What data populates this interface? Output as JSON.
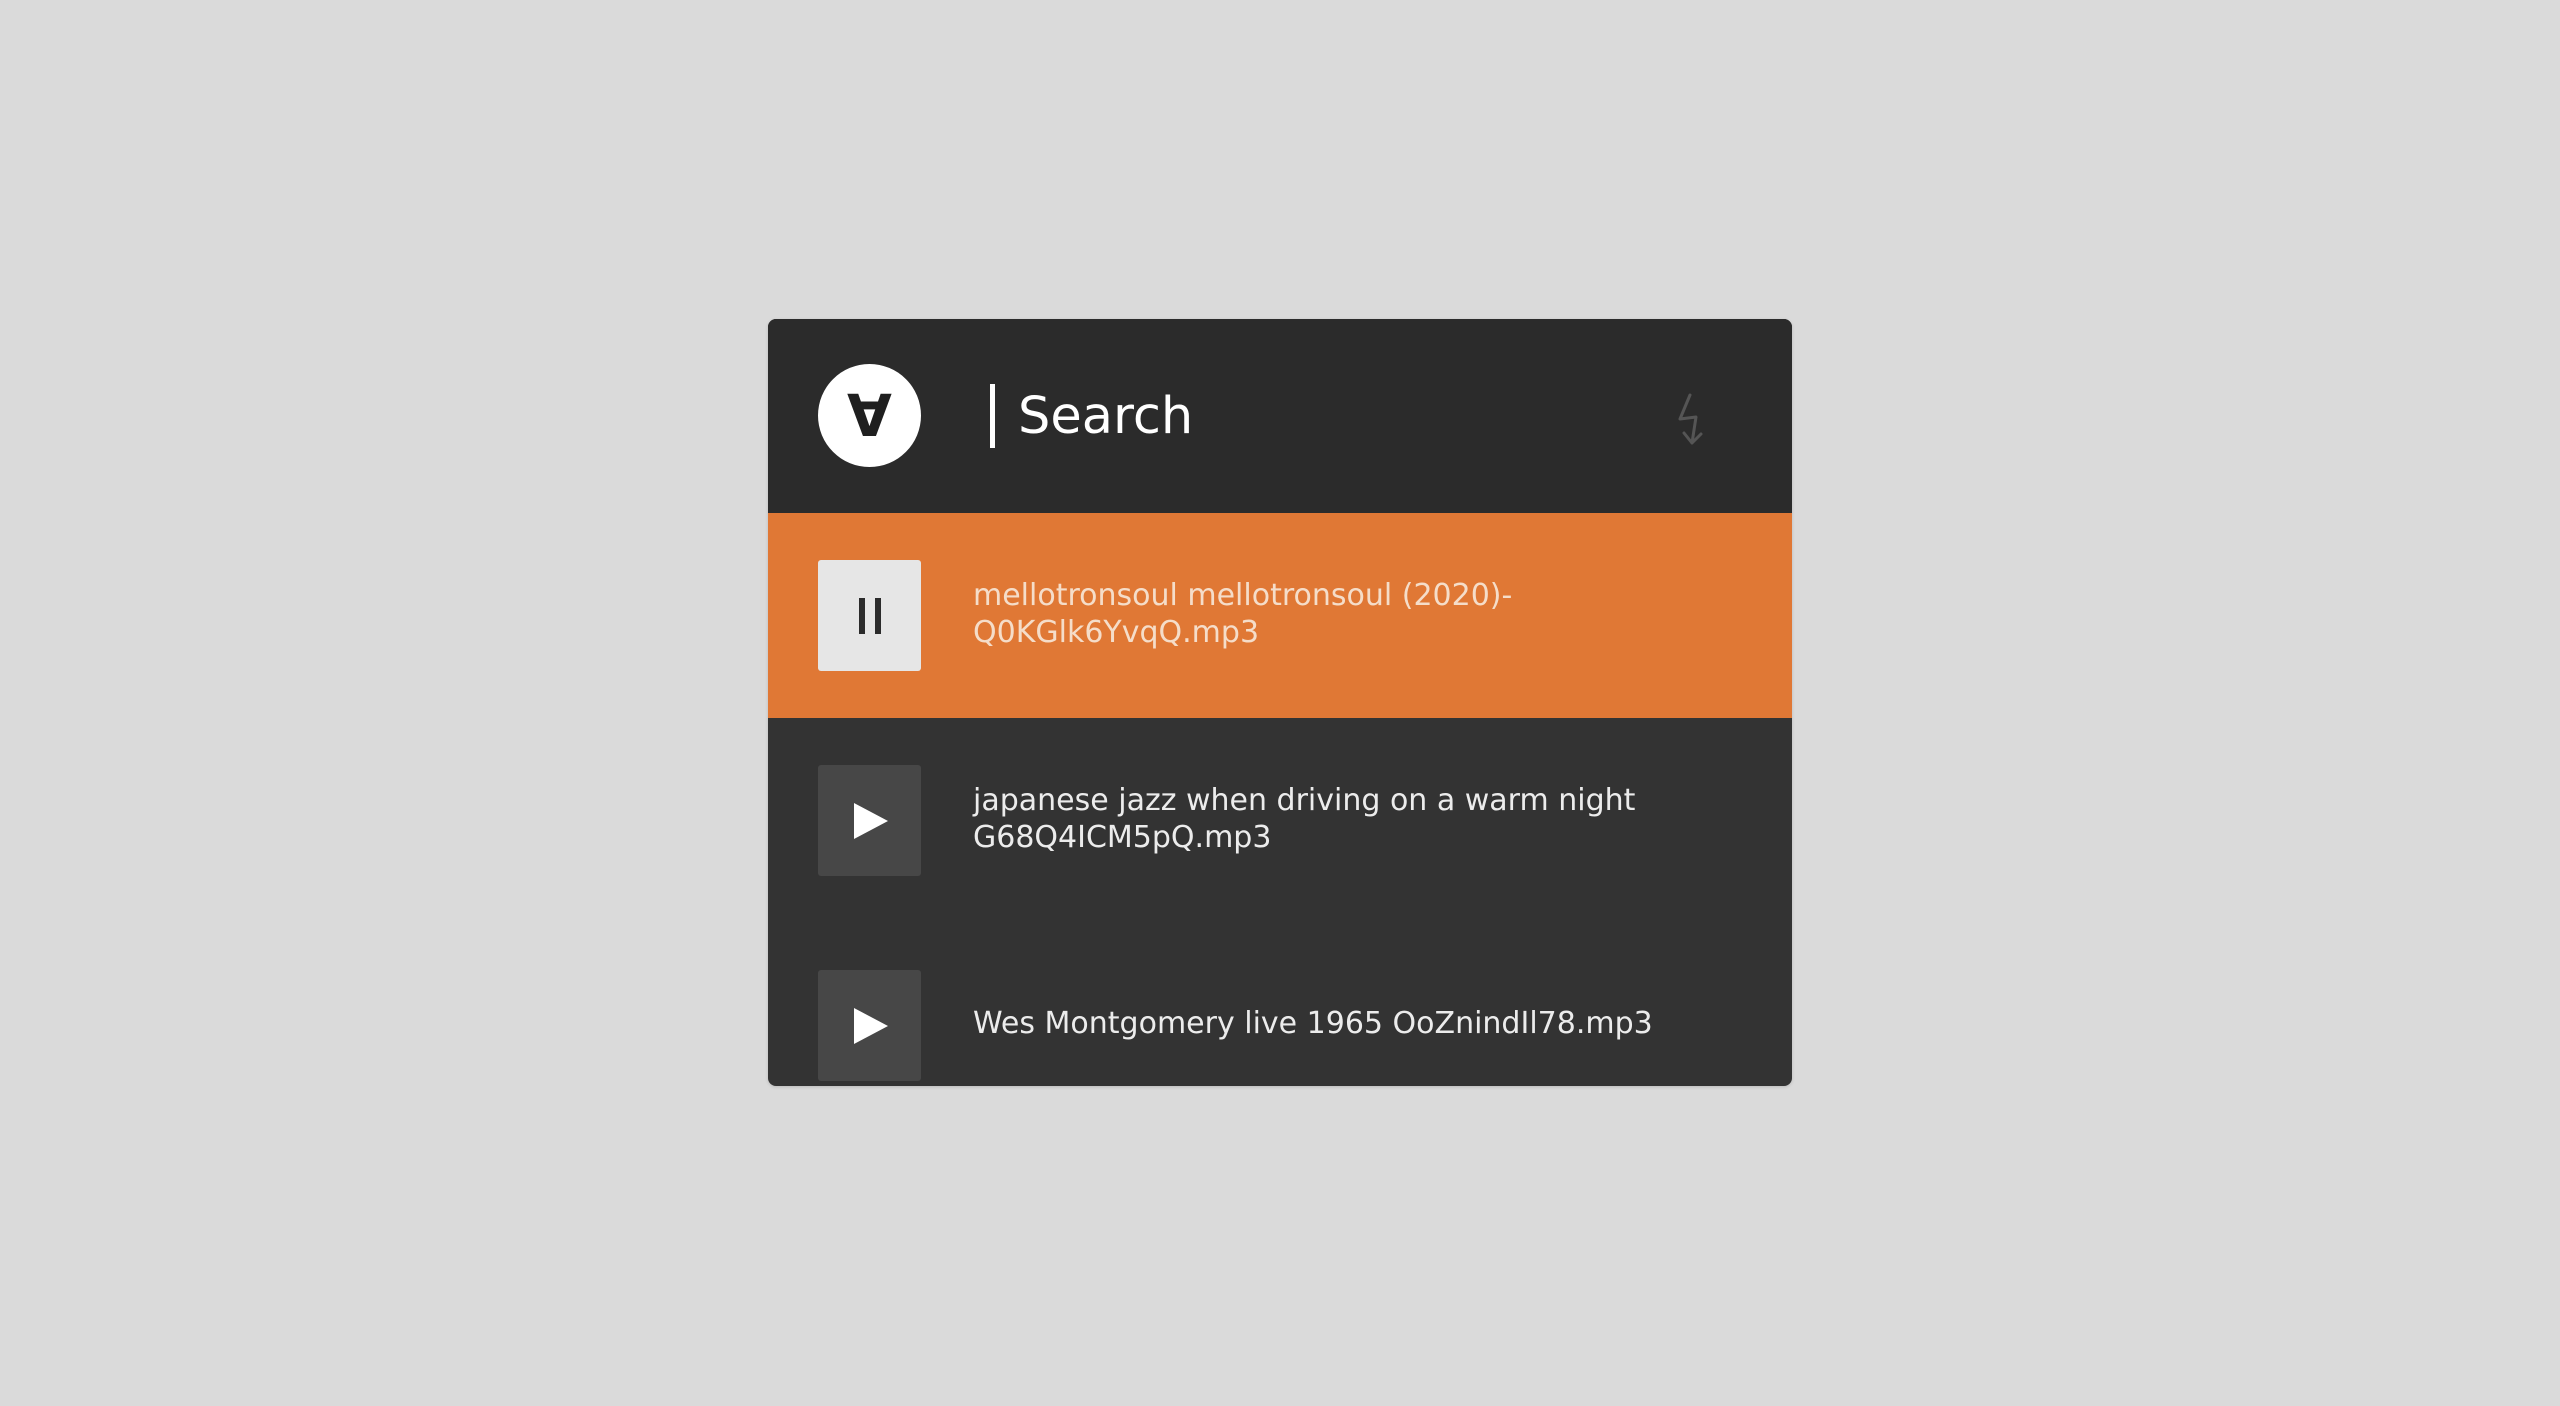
{
  "search": {
    "placeholder": "Search"
  },
  "logo": {
    "glyph": "∀"
  },
  "icons": {
    "logo": "for-all-symbol",
    "shuffle": "lightning-bolt-icon",
    "pause": "pause-icon",
    "play": "play-icon"
  },
  "tracks": [
    {
      "title": "mellotronsoul mellotronsoul (2020)-Q0KGlk6YvqQ.mp3",
      "state": "playing",
      "button_glyph": "II"
    },
    {
      "title": "japanese jazz when driving on a warm night G68Q4ICM5pQ.mp3",
      "state": "paused",
      "button_glyph": "▶"
    },
    {
      "title": "Wes Montgomery live 1965 OoZnindIl78.mp3",
      "state": "paused",
      "button_glyph": "▶"
    }
  ],
  "colors": {
    "background": "#dadada",
    "panel": "#333333",
    "header": "#2b2b2b",
    "active_row": "#e07835",
    "active_text": "#f5ddc9",
    "text": "#ececec"
  }
}
